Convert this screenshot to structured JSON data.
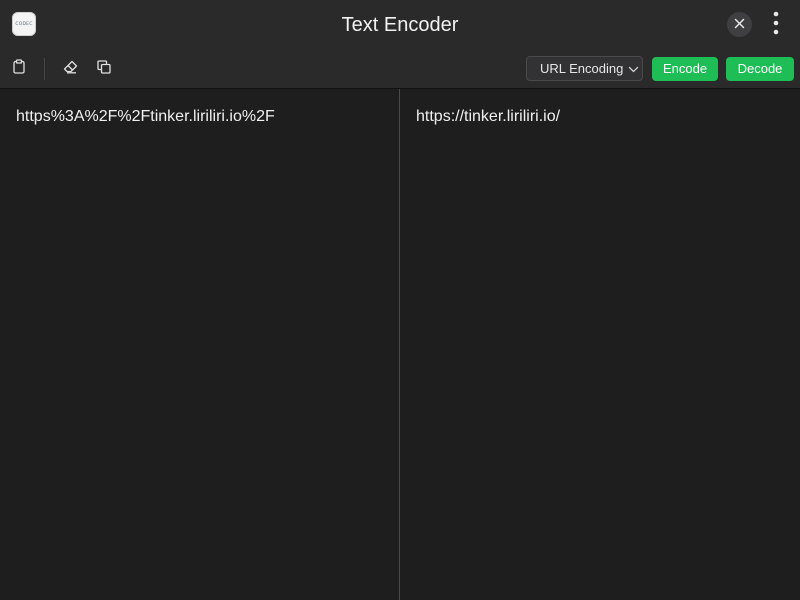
{
  "app": {
    "title": "Text Encoder",
    "icon_text": "CODEC"
  },
  "toolbar": {
    "paste_icon": "clipboard-icon",
    "clear_icon": "eraser-icon",
    "copy_icon": "copy-icon",
    "encoding_select": {
      "selected": "URL Encoding"
    },
    "encode_label": "Encode",
    "decode_label": "Decode"
  },
  "panes": {
    "input": "https%3A%2F%2Ftinker.liriliri.io%2F",
    "output": "https://tinker.liriliri.io/"
  },
  "colors": {
    "background": "#1e1e1e",
    "bar": "#2a2a2b",
    "accent": "#1fbd56"
  }
}
